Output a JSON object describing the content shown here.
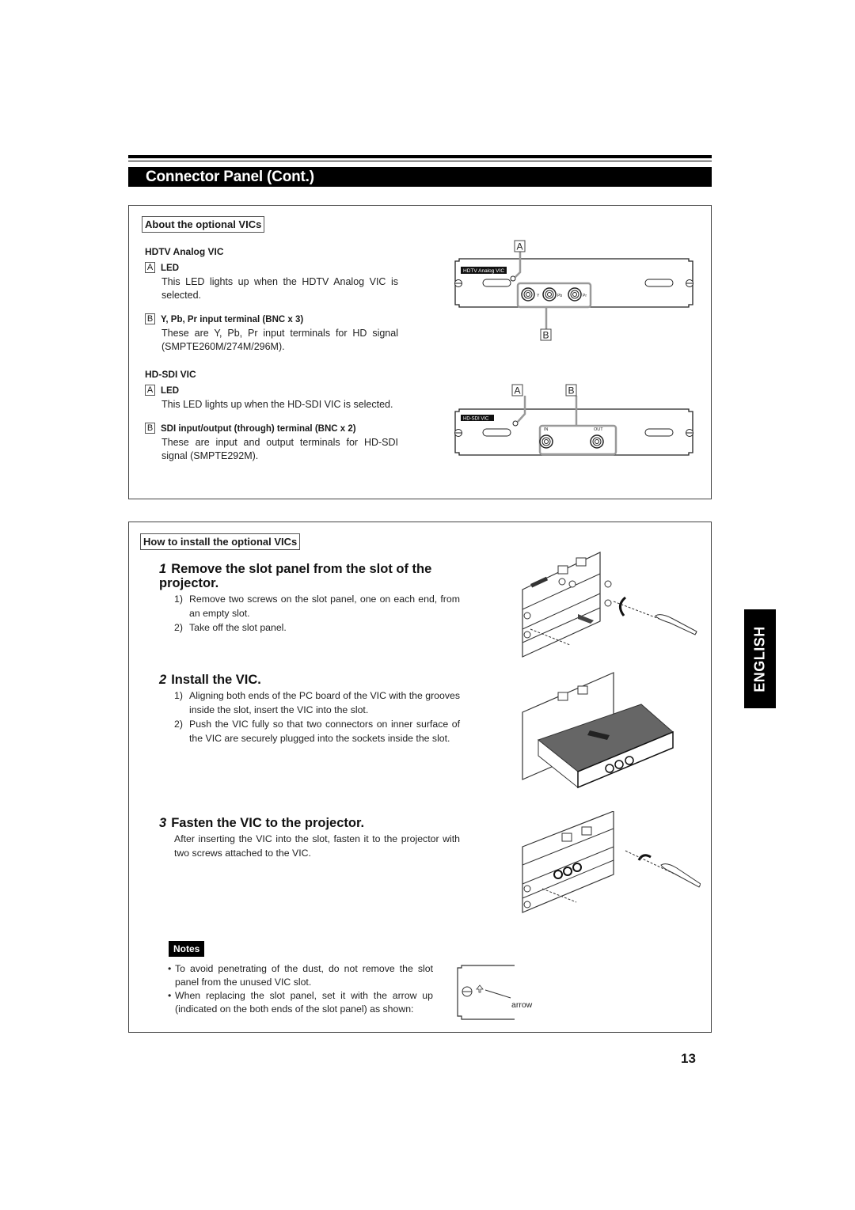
{
  "header": {
    "title": "Connector Panel (Cont.)"
  },
  "about_section": {
    "label": "About the optional VICs",
    "hdtv": {
      "heading": "HDTV Analog VIC",
      "items": [
        {
          "marker": "A",
          "title": "LED",
          "text": "This LED lights up when the HDTV Analog VIC is selected."
        },
        {
          "marker": "B",
          "title": "Y, Pb, Pr input terminal (BNC x 3)",
          "text": "These are Y, Pb, Pr input terminals for HD signal (SMPTE260M/274M/296M)."
        }
      ]
    },
    "hdsdi": {
      "heading": "HD-SDI VIC",
      "items": [
        {
          "marker": "A",
          "title": "LED",
          "text": "This LED lights up when the HD-SDI VIC is selected."
        },
        {
          "marker": "B",
          "title": "SDI input/output (through) terminal (BNC x 2)",
          "text": "These are input and output terminals for HD-SDI signal (SMPTE292M)."
        }
      ]
    },
    "diagram_hdtv": {
      "panel_label": "HDTV Analog VIC",
      "callout_a": "A",
      "callout_b": "B",
      "connectors": [
        "Y",
        "Pb",
        "Pr"
      ]
    },
    "diagram_hdsdi": {
      "panel_label": "HD-SDI VIC",
      "callout_a": "A",
      "callout_b": "B",
      "connectors": [
        "IN",
        "OUT"
      ]
    }
  },
  "install_section": {
    "label": "How to install the optional VICs",
    "steps": [
      {
        "number": "1",
        "title": "Remove the slot panel from the slot of the projector.",
        "items": [
          {
            "n": "1)",
            "text": "Remove two screws on the slot panel, one on each end, from an empty slot."
          },
          {
            "n": "2)",
            "text": "Take off the slot panel."
          }
        ]
      },
      {
        "number": "2",
        "title": "Install the VIC.",
        "items": [
          {
            "n": "1)",
            "text": "Aligning both ends of the PC board of the VIC with the grooves inside the slot, insert the VIC into the slot."
          },
          {
            "n": "2)",
            "text": "Push the VIC fully so that two connectors on inner surface of the VIC are securely plugged into the sockets inside the slot."
          }
        ]
      },
      {
        "number": "3",
        "title": "Fasten the VIC to the projector.",
        "text": "After inserting the VIC into the slot, fasten it to the projector with two screws attached to the VIC."
      }
    ],
    "notes": {
      "badge": "Notes",
      "items": [
        "To avoid penetrating of the dust, do not remove the slot panel from the unused VIC slot.",
        "When replacing the slot panel, set it with the arrow up (indicated on the both ends of the slot panel) as shown:"
      ],
      "diagram_label": "arrow",
      "bullet": "•"
    }
  },
  "side_tab": "ENGLISH",
  "page_number": "13"
}
